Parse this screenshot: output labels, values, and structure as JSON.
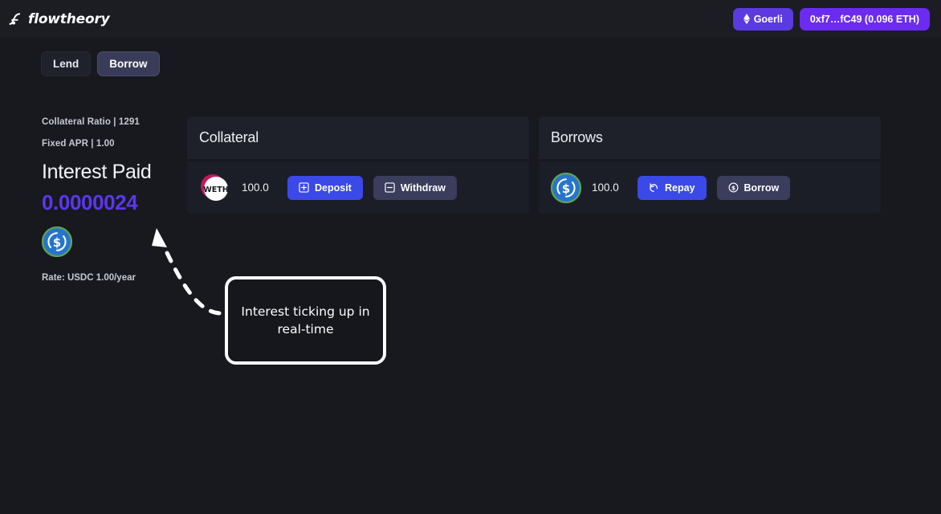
{
  "brand": {
    "name": "flowtheory",
    "logo_icon": "flowtheory-logo-icon"
  },
  "topbar": {
    "chain_button": {
      "label": "Goerli",
      "icon": "ethereum-diamond-icon",
      "color": "#5b3ae0"
    },
    "account_button": {
      "label": "0xf7…fC49 (0.096 ETH)",
      "color": "#6c2bf0"
    }
  },
  "tabs": [
    {
      "label": "Lend",
      "active": false
    },
    {
      "label": "Borrow",
      "active": true
    }
  ],
  "stats": {
    "collateral_ratio": "Collateral Ratio | 1291",
    "fixed_apr": "Fixed APR | 1.00",
    "interest_paid_title": "Interest Paid",
    "interest_paid_value": "0.0000024",
    "interest_value_color": "#5c36ef",
    "token_icon": "usdc-token-icon",
    "rate": "Rate: USDC 1.00/year"
  },
  "collateral": {
    "title": "Collateral",
    "rows": [
      {
        "token_icon": "weth-token-icon",
        "amount": "100.0",
        "primary_action": {
          "label": "Deposit",
          "icon": "plus-square-icon"
        },
        "secondary_action": {
          "label": "Withdraw",
          "icon": "minus-square-icon"
        }
      }
    ]
  },
  "borrows": {
    "title": "Borrows",
    "rows": [
      {
        "token_icon": "usdc-token-icon",
        "amount": "100.0",
        "primary_action": {
          "label": "Repay",
          "icon": "undo-arrow-icon"
        },
        "secondary_action": {
          "label": "Borrow",
          "icon": "dollar-circle-icon"
        }
      }
    ]
  },
  "annotation": {
    "text": "Interest ticking up in real-time",
    "arrow_icon": "dashed-curved-arrow-icon"
  },
  "theme": {
    "page_bg": "#17191f",
    "card_bg": "#1c1e27",
    "card_header_bg": "#1e202a",
    "primary_button": "#3b49e8",
    "secondary_button": "#3a3d5c"
  }
}
